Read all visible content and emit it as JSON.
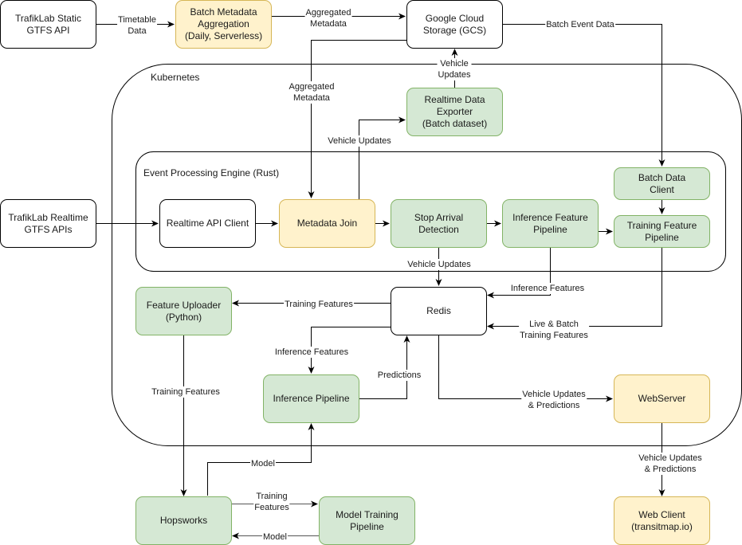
{
  "containers": {
    "kubernetes": "Kubernetes",
    "event_engine": "Event Processing Engine (Rust)"
  },
  "nodes": {
    "static_api": "TrafikLab Static\nGTFS API",
    "batch_meta": "Batch Metadata\nAggregation\n(Daily, Serverless)",
    "gcs": "Google Cloud\nStorage (GCS)",
    "realtime_exporter": "Realtime Data\nExporter\n(Batch dataset)",
    "realtime_apis": "TrafikLab Realtime\nGTFS APIs",
    "realtime_client": "Realtime API Client",
    "metadata_join": "Metadata Join",
    "stop_arrival": "Stop Arrival\nDetection",
    "inference_feature": "Inference Feature\nPipeline",
    "batch_client": "Batch Data\nClient",
    "training_feature": "Training Feature\nPipeline",
    "redis": "Redis",
    "feature_uploader": "Feature Uploader\n(Python)",
    "inference_pipeline": "Inference Pipeline",
    "webserver": "WebServer",
    "hopsworks": "Hopsworks",
    "model_training": "Model Training\nPipeline",
    "web_client": "Web Client\n(transitmap.io)"
  },
  "edges": {
    "timetable": "Timetable\nData",
    "agg_meta_top": "Aggregated\nMetadata",
    "batch_event": "Batch Event Data",
    "vehicle_updates_gcs": "Vehicle\nUpdates",
    "agg_meta_down": "Aggregated\nMetadata",
    "vehicle_updates_exporter": "Vehicle Updates",
    "vehicle_updates_redis": "Vehicle Updates",
    "inference_features_redis": "Inference Features",
    "training_features_uploader": "Training Features",
    "live_batch": "Live & Batch\nTraining Features",
    "inference_features_pipeline": "Inference Features",
    "predictions": "Predictions",
    "training_features_hops": "Training Features",
    "vehicle_preds_web": "Vehicle Updates\n& Predictions",
    "vehicle_preds_client": "Vehicle Updates\n& Predictions",
    "model_up": "Model",
    "training_features_mt": "Training\nFeatures",
    "model_back": "Model"
  },
  "colors": {
    "yellow_fill": "#fff2cc",
    "yellow_stroke": "#d6b656",
    "green_fill": "#d5e8d4",
    "green_stroke": "#82b366",
    "line": "#000000",
    "line_gray": "#555555"
  }
}
